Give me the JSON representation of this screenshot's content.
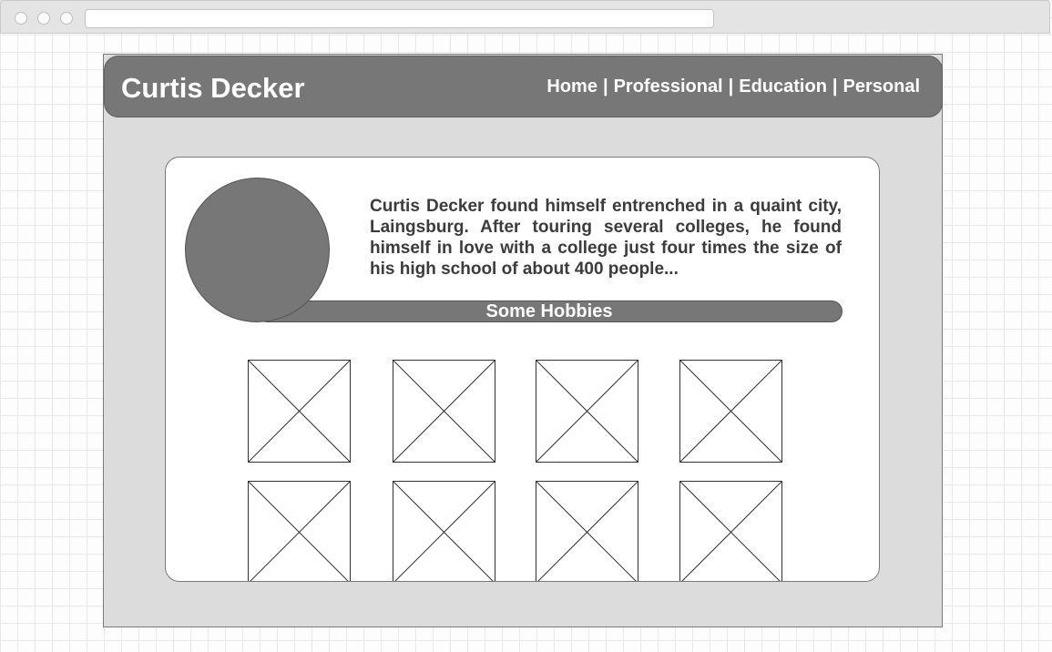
{
  "site": {
    "title": "Curtis Decker"
  },
  "nav": {
    "items": [
      {
        "label": "Home"
      },
      {
        "label": "Professional"
      },
      {
        "label": "Education"
      },
      {
        "label": "Personal"
      }
    ],
    "separator": "|"
  },
  "profile": {
    "bio": "Curtis Decker found himself entrenched in a quaint city, Laingsburg. After touring several colleges, he found himself in love with a college just four times the size of his high school of about 400 people..."
  },
  "hobbies": {
    "title": "Some Hobbies",
    "image_count": 8
  },
  "colors": {
    "header_bg": "#777777",
    "page_bg": "#dcdcdc",
    "card_bg": "#ffffff",
    "text": "#3c3c3c"
  }
}
